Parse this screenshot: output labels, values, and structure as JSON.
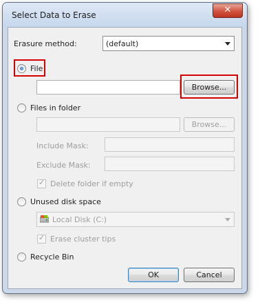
{
  "window": {
    "title": "Select Data to Erase",
    "close_symbol": "✕"
  },
  "erasure": {
    "label": "Erasure method:",
    "selected": "(default)"
  },
  "file": {
    "label": "File",
    "path": "",
    "browse_label": "Browse..."
  },
  "folder": {
    "label": "Files in folder",
    "path": "",
    "browse_label": "Browse...",
    "include_label": "Include Mask:",
    "include_value": "",
    "exclude_label": "Exclude Mask:",
    "exclude_value": "",
    "delete_label": "Delete folder if empty"
  },
  "unused": {
    "label": "Unused disk space",
    "drive": "Local Disk (C:)",
    "cluster_label": "Erase cluster tips"
  },
  "recycle": {
    "label": "Recycle Bin"
  },
  "buttons": {
    "ok": "OK",
    "cancel": "Cancel"
  },
  "icons": {
    "close": "close-icon",
    "dropdown": "chevron-down-icon",
    "drive": "drive-icon",
    "check": "check-icon"
  },
  "colors": {
    "highlight": "#d40000",
    "title_gradient_top": "#dfe9f6",
    "client_bg": "#f0f0f0"
  }
}
